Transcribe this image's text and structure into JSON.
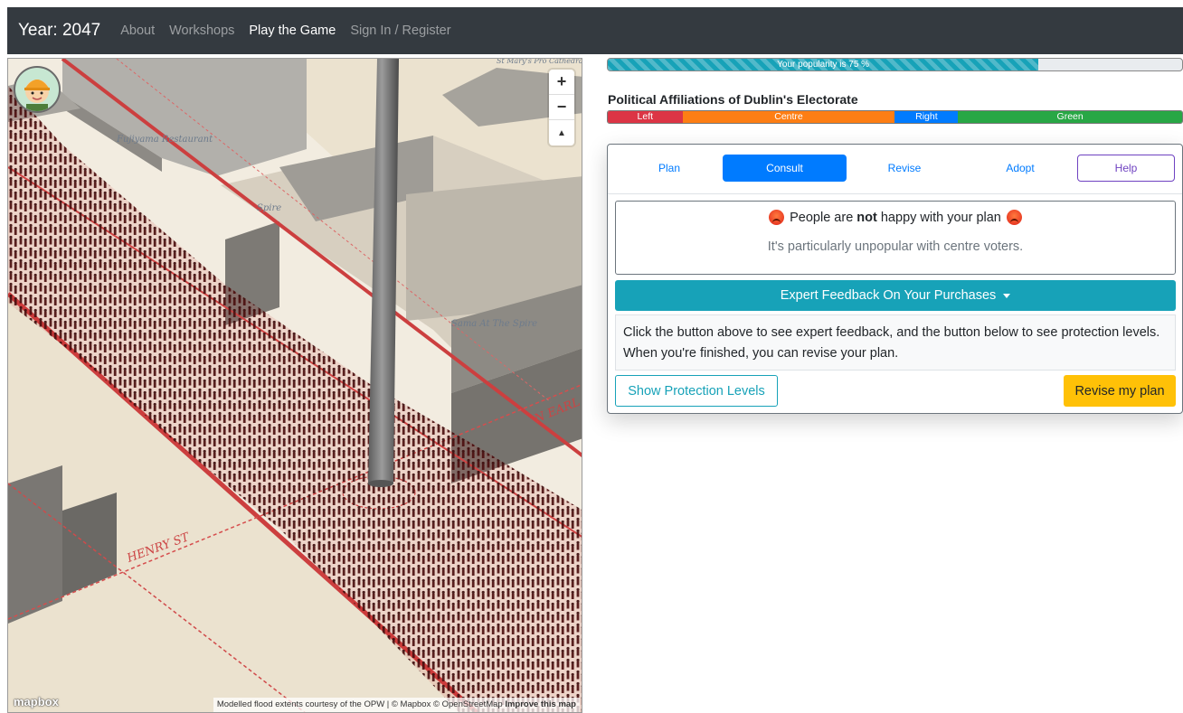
{
  "navbar": {
    "brand": "Year: 2047",
    "links": [
      {
        "label": "About",
        "active": false
      },
      {
        "label": "Workshops",
        "active": false
      },
      {
        "label": "Play the Game",
        "active": true
      },
      {
        "label": "Sign In / Register",
        "active": false
      }
    ]
  },
  "map": {
    "zoom_in": "+",
    "zoom_out": "−",
    "compass": "▲",
    "streets": {
      "henry": "HENRY ST",
      "earl": "N EARL ST"
    },
    "pois": {
      "fujiyama": "Fujiyama Restaurant",
      "spire": "Spire",
      "sama": "Sama At The Spire",
      "stmary": "St Mary's Pro Cathedral"
    },
    "attribution_text": "Modelled flood extents courtesy of the OPW | © Mapbox © OpenStreetMap",
    "improve_link": "Improve this map",
    "logo": "mapbox"
  },
  "popularity": {
    "label": "Your popularity is 75 %",
    "value": 0.75
  },
  "affiliations": {
    "title": "Political Affiliations of Dublin's Electorate",
    "segments": [
      {
        "label": "Left",
        "fraction": 0.13,
        "color": "#dc3545"
      },
      {
        "label": "Centre",
        "fraction": 0.37,
        "color": "#fd7e14"
      },
      {
        "label": "Right",
        "fraction": 0.11,
        "color": "#007bff"
      },
      {
        "label": "Green",
        "fraction": 0.39,
        "color": "#28a745"
      }
    ]
  },
  "tabs": {
    "plan": "Plan",
    "consult": "Consult",
    "revise": "Revise",
    "adopt": "Adopt",
    "help": "Help"
  },
  "feedback": {
    "prefix": "People are ",
    "emphasis": "not",
    "suffix": " happy with your plan",
    "sub": "It's particularly unpopular with centre voters."
  },
  "expert_button": "Expert Feedback On Your Purchases",
  "info_text": "Click the button above to see expert feedback, and the button below to see protection levels. When you're finished, you can revise your plan.",
  "buttons": {
    "protection": "Show Protection Levels",
    "revise": "Revise my plan"
  }
}
